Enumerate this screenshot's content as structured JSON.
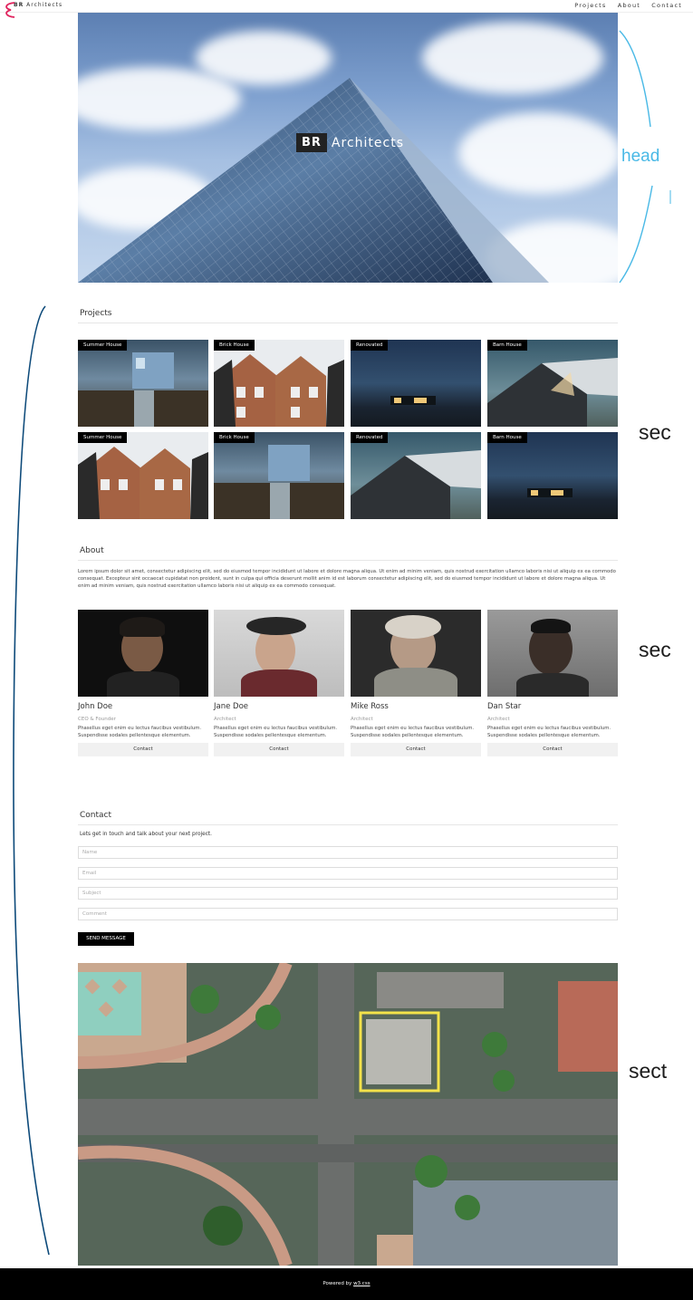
{
  "brand": {
    "initials": "BR",
    "name": "Architects"
  },
  "nav": {
    "items": [
      "Projects",
      "About",
      "Contact"
    ]
  },
  "hero": {
    "logo_initials": "BR",
    "logo_name": "Architects"
  },
  "annotations": {
    "header": "head",
    "section_1": "sec",
    "section_2": "sec",
    "section_3": "sect"
  },
  "projects": {
    "title": "Projects",
    "tiles": [
      {
        "label": "Summer House"
      },
      {
        "label": "Brick House"
      },
      {
        "label": "Renovated"
      },
      {
        "label": "Barn House"
      },
      {
        "label": "Summer House"
      },
      {
        "label": "Brick House"
      },
      {
        "label": "Renovated"
      },
      {
        "label": "Barn House"
      }
    ]
  },
  "about": {
    "title": "About",
    "text": "Lorem ipsum dolor sit amet, consectetur adipiscing elit, sed do eiusmod tempor incididunt ut labore et dolore magna aliqua. Ut enim ad minim veniam, quis nostrud exercitation ullamco laboris nisi ut aliquip ex ea commodo consequat. Excepteur sint occaecat cupidatat non proident, sunt in culpa qui officia deserunt mollit anim id est laborum consectetur adipiscing elit, sed do eiusmod tempor incididunt ut labore et dolore magna aliqua. Ut enim ad minim veniam, quis nostrud exercitation ullamco laboris nisi ut aliquip ex ea commodo consequat.",
    "team": [
      {
        "name": "John Doe",
        "role": "CEO & Founder",
        "desc": "Phasellus eget enim eu lectus faucibus vestibulum. Suspendisse sodales pellentesque elementum.",
        "button": "Contact"
      },
      {
        "name": "Jane Doe",
        "role": "Architect",
        "desc": "Phasellus eget enim eu lectus faucibus vestibulum. Suspendisse sodales pellentesque elementum.",
        "button": "Contact"
      },
      {
        "name": "Mike Ross",
        "role": "Architect",
        "desc": "Phasellus eget enim eu lectus faucibus vestibulum. Suspendisse sodales pellentesque elementum.",
        "button": "Contact"
      },
      {
        "name": "Dan Star",
        "role": "Architect",
        "desc": "Phasellus eget enim eu lectus faucibus vestibulum. Suspendisse sodales pellentesque elementum.",
        "button": "Contact"
      }
    ]
  },
  "contact": {
    "title": "Contact",
    "intro": "Lets get in touch and talk about your next project.",
    "fields": {
      "name": "Name",
      "email": "Email",
      "subject": "Subject",
      "comment": "Comment"
    },
    "send": "SEND MESSAGE"
  },
  "footer": {
    "text": "Powered by",
    "link": "w3.css"
  },
  "colors": {
    "accent_annotation": "#49b9e6",
    "bracket_left": "#0d4a7a",
    "bracket_corner": "#e0245e",
    "footer_bg": "#000000"
  }
}
